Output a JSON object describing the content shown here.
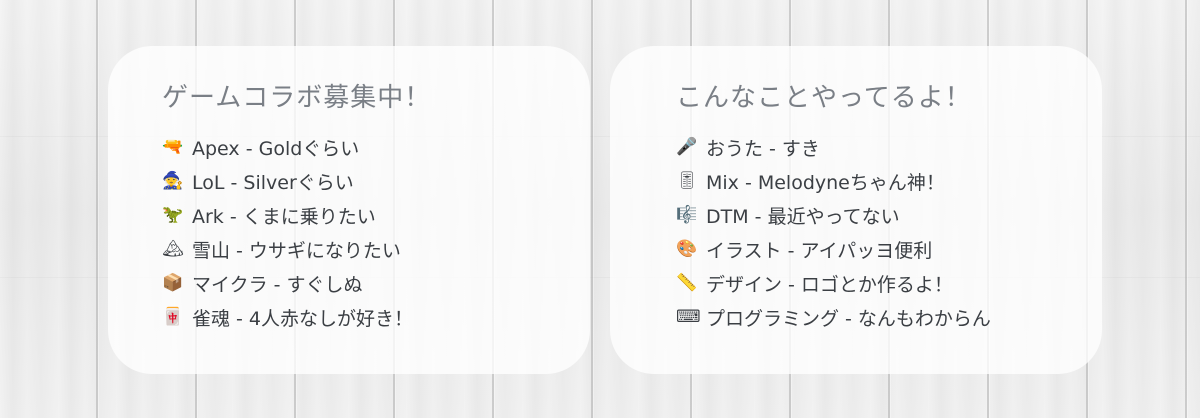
{
  "left_card": {
    "title": "ゲームコラボ募集中！",
    "items": [
      {
        "icon": "water-pistol-icon",
        "glyph": "🔫",
        "text": "Apex - Goldぐらい"
      },
      {
        "icon": "mage-icon",
        "glyph": "🧙",
        "text": "LoL - Silverぐらい"
      },
      {
        "icon": "t-rex-icon",
        "glyph": "🦖",
        "text": "Ark - くまに乗りたい"
      },
      {
        "icon": "snow-mountain-icon",
        "glyph": "🏔",
        "text": "雪山 - ウサギになりたい"
      },
      {
        "icon": "package-icon",
        "glyph": "📦",
        "text": "マイクラ - すぐしぬ"
      },
      {
        "icon": "mahjong-tile-icon",
        "glyph": "🀄",
        "text": "雀魂 - 4人赤なしが好き！"
      }
    ]
  },
  "right_card": {
    "title": "こんなことやってるよ！",
    "items": [
      {
        "icon": "microphone-icon",
        "glyph": "🎤",
        "text": "おうた - すき"
      },
      {
        "icon": "mixer-fader-icon",
        "glyph": "🎚",
        "text": "Mix - Melodyneちゃん神！"
      },
      {
        "icon": "musical-score-icon",
        "glyph": "🎼",
        "text": "DTM - 最近やってない"
      },
      {
        "icon": "palette-icon",
        "glyph": "🎨",
        "text": "イラスト - アイパッヨ便利"
      },
      {
        "icon": "ruler-icon",
        "glyph": "📏",
        "text": "デザイン - ロゴとか作るよ！"
      },
      {
        "icon": "keyboard-icon",
        "glyph": "⌨",
        "text": "プログラミング - なんもわからん"
      }
    ]
  }
}
